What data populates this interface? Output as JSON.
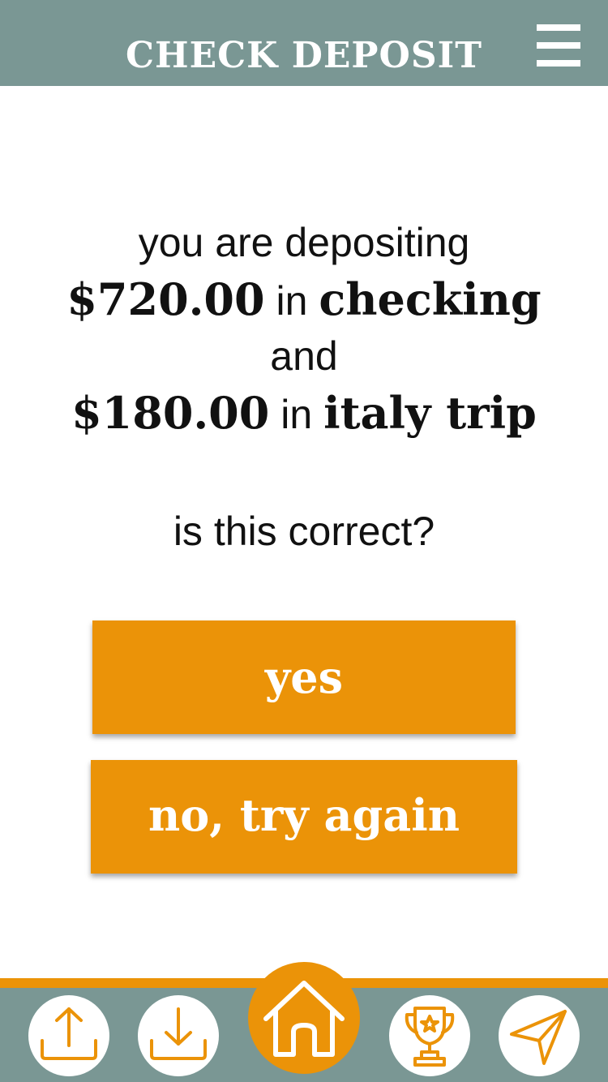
{
  "header": {
    "title": "CHECK DEPOSIT",
    "menu_icon": "hamburger-menu-icon"
  },
  "summary": {
    "line1": "you are depositing",
    "amount1": "$720.00",
    "connector1": "in",
    "account1": "checking",
    "line3": "and",
    "amount2": "$180.00",
    "connector2": "in",
    "account2": "italy trip"
  },
  "question": "is this correct?",
  "buttons": {
    "yes": "yes",
    "retry": "no, try again"
  },
  "tabbar": {
    "items": [
      {
        "icon": "upload-icon"
      },
      {
        "icon": "download-icon"
      },
      {
        "icon": "home-icon"
      },
      {
        "icon": "trophy-icon"
      },
      {
        "icon": "send-icon"
      }
    ]
  },
  "colors": {
    "header": "#7a9794",
    "accent": "#eb9308",
    "text": "#111111"
  }
}
